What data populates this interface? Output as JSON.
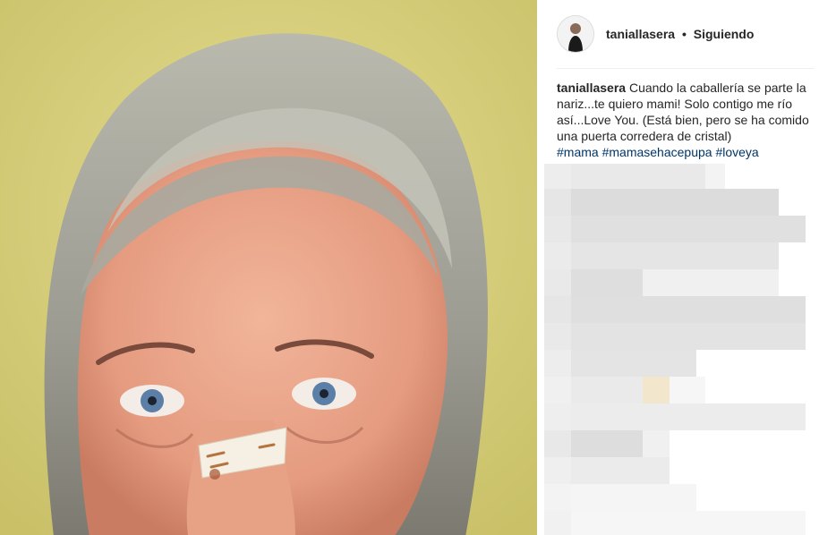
{
  "post": {
    "username": "taniallasera",
    "separator": "•",
    "follow_status": "Siguiendo"
  },
  "caption": {
    "username": "taniallasera",
    "text": "Cuando la caballería se parte la nariz...te quiero mami! Solo contigo me río así...Love You. (Está bien, pero se ha comido una puerta corredera de cristal)",
    "hashtags": [
      "#mama",
      "#mamasehacepupa",
      "#loveya"
    ]
  },
  "colors": {
    "photo_background": "#d9d07c",
    "hashtag": "#003569",
    "divider": "#efefef"
  },
  "icons": {
    "avatar": "profile-photo"
  }
}
